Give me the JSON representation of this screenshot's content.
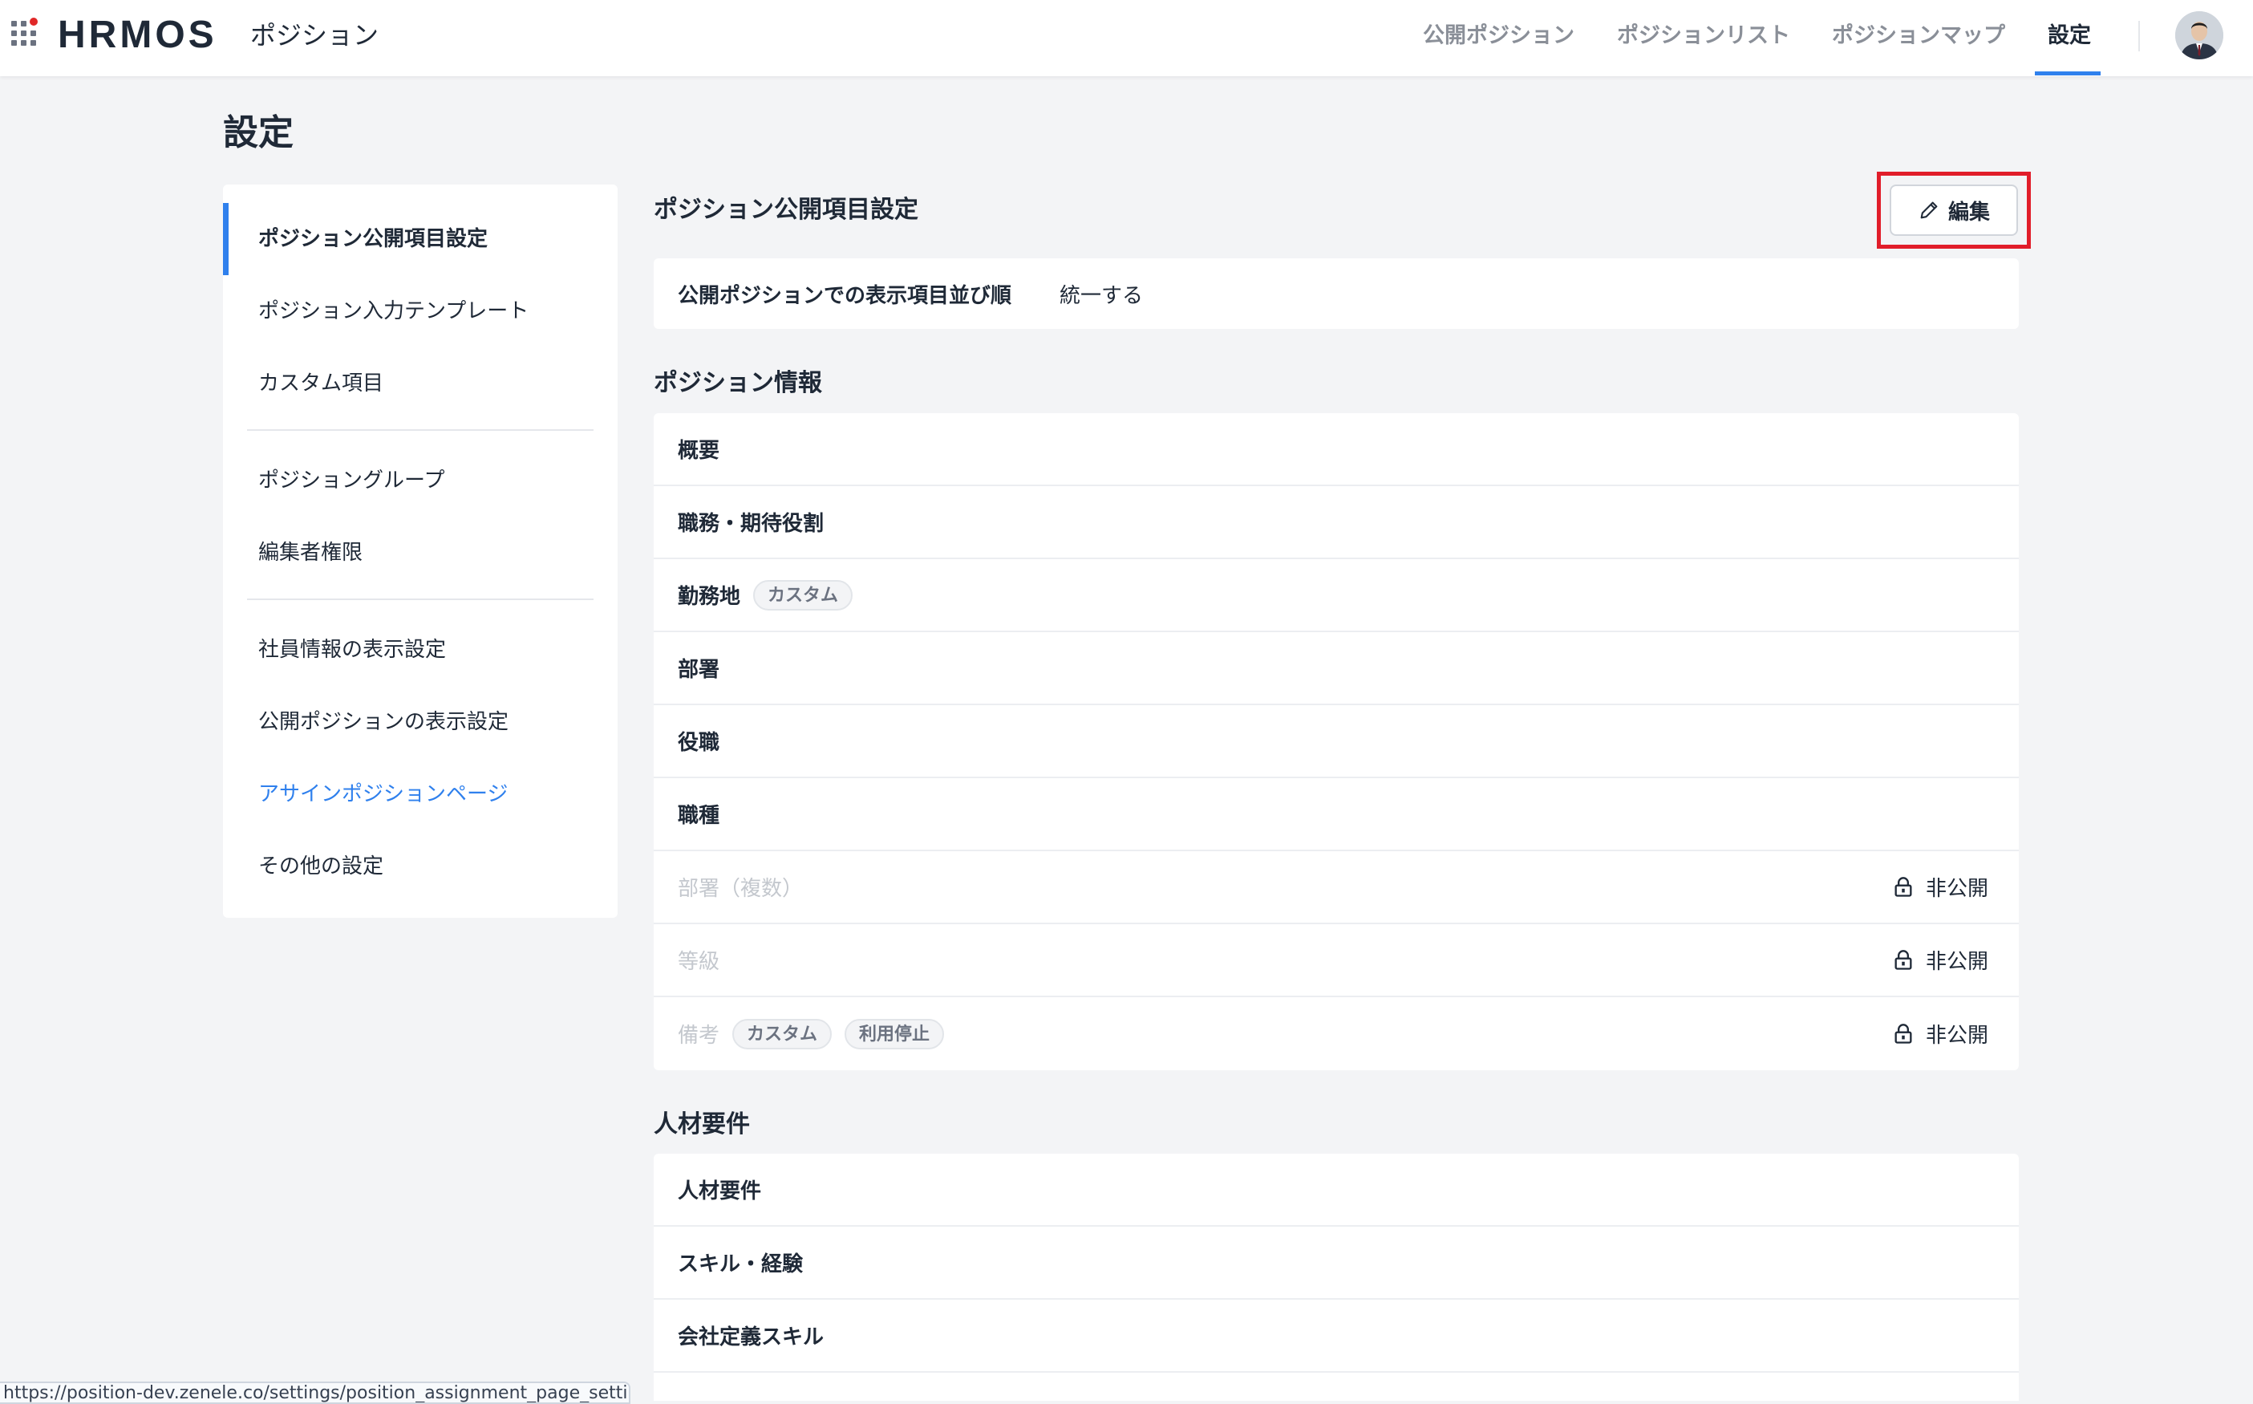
{
  "header": {
    "logo": "HRMOS",
    "product": "ポジション",
    "nav": [
      "公開ポジション",
      "ポジションリスト",
      "ポジションマップ",
      "設定"
    ],
    "active_nav": "設定"
  },
  "page": {
    "title": "設定"
  },
  "sidebar": {
    "items": [
      "ポジション公開項目設定",
      "ポジション入力テンプレート",
      "カスタム項目",
      "ポジショングループ",
      "編集者権限",
      "社員情報の表示設定",
      "公開ポジションの表示設定",
      "アサインポジションページ",
      "その他の設定"
    ],
    "active": "ポジション公開項目設定",
    "hovered_link": "アサインポジションページ"
  },
  "main": {
    "title": "ポジション公開項目設定",
    "edit_label": "編集",
    "order_setting": {
      "label": "公開ポジションでの表示項目並び順",
      "value": "統一する"
    },
    "position_info": {
      "title": "ポジション情報",
      "rows": [
        {
          "label": "概要"
        },
        {
          "label": "職務・期待役割"
        },
        {
          "label": "勤務地",
          "tags": [
            "カスタム"
          ]
        },
        {
          "label": "部署"
        },
        {
          "label": "役職"
        },
        {
          "label": "職種"
        },
        {
          "label": "部署（複数）",
          "status": "非公開"
        },
        {
          "label": "等級",
          "status": "非公開"
        },
        {
          "label": "備考",
          "tags": [
            "カスタム",
            "利用停止"
          ],
          "status": "非公開"
        }
      ]
    },
    "talent_req": {
      "title": "人材要件",
      "rows": [
        {
          "label": "人材要件"
        },
        {
          "label": "スキル・経験"
        },
        {
          "label": "会社定義スキル"
        }
      ]
    }
  },
  "status_bar": {
    "url": "https://position-dev.zenele.co/settings/position_assignment_page_setting"
  },
  "colors": {
    "accent": "#2f80ed",
    "highlight": "#e11d2a",
    "brand_dot": "#e02828"
  }
}
